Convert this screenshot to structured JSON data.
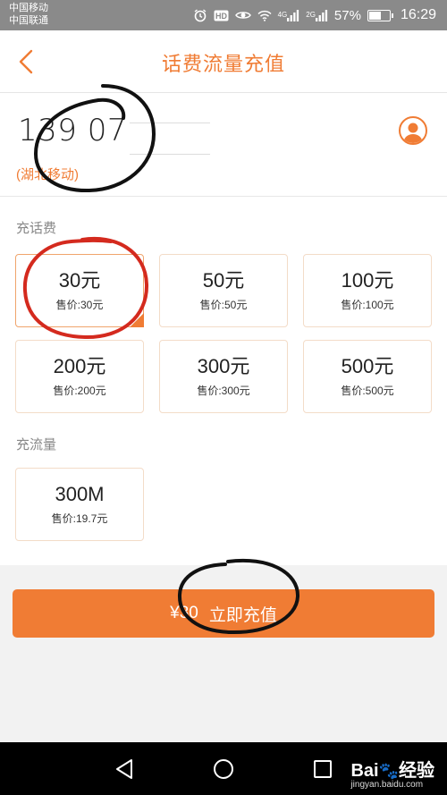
{
  "status_bar": {
    "carrier_1": "中国移动",
    "carrier_2": "中国联通",
    "network_1": "4G",
    "network_2": "2G",
    "battery": "57%",
    "time": "16:29"
  },
  "header": {
    "title": "话费流量充值",
    "back_icon": "chevron-left-icon"
  },
  "phone": {
    "number": "139 07",
    "operator": "(湖北移动)",
    "contact_icon": "person-icon"
  },
  "call_credit": {
    "label": "充话费",
    "options": [
      {
        "amount": "30元",
        "price": "售价:30元",
        "selected": true
      },
      {
        "amount": "50元",
        "price": "售价:50元",
        "selected": false
      },
      {
        "amount": "100元",
        "price": "售价:100元",
        "selected": false
      },
      {
        "amount": "200元",
        "price": "售价:200元",
        "selected": false
      },
      {
        "amount": "300元",
        "price": "售价:300元",
        "selected": false
      },
      {
        "amount": "500元",
        "price": "售价:500元",
        "selected": false
      }
    ]
  },
  "data_plan": {
    "label": "充流量",
    "options": [
      {
        "amount": "300M",
        "price": "售价:19.7元",
        "selected": false
      }
    ]
  },
  "action": {
    "price": "¥30",
    "label": "立即充值"
  },
  "watermark": {
    "logo": "Bai",
    "logo_suffix": "经验",
    "url": "jingyan.baidu.com"
  },
  "colors": {
    "accent": "#f07c34",
    "status_bar": "#8a8a8a",
    "annotation_red": "#d42a1e",
    "annotation_black": "#111111"
  }
}
